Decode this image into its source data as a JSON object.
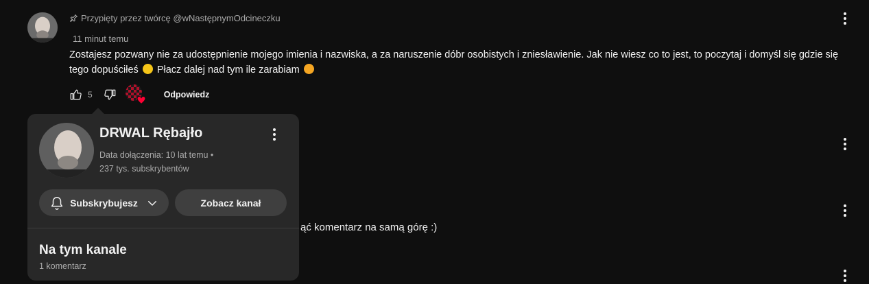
{
  "pinned_comment": {
    "pinned_by": "Przypięty przez twórcę @wNastępnymOdcineczku",
    "time": "11 minut temu",
    "text_part1": "Zostajesz pozwany nie za udostępnienie mojego imienia i nazwiska, a za naruszenie dóbr osobistych i zniesławienie. Jak nie wiesz co to jest, to poczytaj i domyśl się gdzie się tego dopuściłeś",
    "text_part2": "Płacz dalej nad tym ile zarabiam",
    "like_count": "5",
    "reply_label": "Odpowiedz",
    "icons": {
      "pin": "pin-icon",
      "like": "thumbs-up-icon",
      "dislike": "thumbs-down-icon",
      "heart": "creator-heart-icon",
      "menu": "more-vert-icon"
    }
  },
  "channel_card": {
    "name": "DRWAL Rębajło",
    "joined": "Data dołączenia: 10 lat temu •",
    "subscribers": "237 tys. subskrybentów",
    "subscribe_label": "Subskrybujesz",
    "view_channel_label": "Zobacz kanał",
    "section_title": "Na tym kanale",
    "section_count": "1 komentarz"
  },
  "background_comment": {
    "partial_text": "ąć komentarz na samą górę :)"
  },
  "colors": {
    "background": "#0f0f0f",
    "card": "#282828",
    "pill": "#3f3f3f",
    "secondary_text": "#aaaaaa",
    "heart": "#ff0033"
  }
}
